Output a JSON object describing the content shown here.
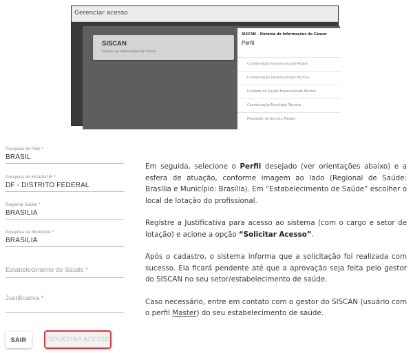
{
  "screenshot": {
    "header": "Gerenciar acesso",
    "card_title": "SISCAN",
    "card_subtitle": "Sistema de Informações do Câncer",
    "panel_system": "SISCAN - Sistema de Informações do Câncer",
    "panel_title": "Perfil",
    "profiles": [
      "Coordenação Intramunicipal Master",
      "Coordenação Intramunicipal Técnica",
      "Unidade de Saúde Especializada Master",
      "Coordenação Municipal Técnica",
      "Prestador de Serviço Master"
    ]
  },
  "form": {
    "pais_label": "Pesquisa de País *",
    "pais_value": "BRASIL",
    "estado_label": "Pesquisa de Estado/UF *",
    "estado_value": "DF - DISTRITO FEDERAL",
    "regional_label": "Regional Saúde *",
    "regional_value": "BRASILIA",
    "municipio_label": "Pesquisa de Município *",
    "municipio_value": "BRASILIA",
    "estabelecimento_placeholder": "Estabelecimento de Saúde *",
    "justificativa_placeholder": "Justificativa *",
    "sair_label": "SAIR",
    "solicitar_label": "SOLICITAR ACESSO"
  },
  "text": {
    "p1_a": "Em seguida, selecione o ",
    "p1_b": "Perfil",
    "p1_c": " desejado (ver orientações abaixo) e a esfera de atuação, conforme imagem ao lado (Regional de Saúde: Brasília e Município: Brasília). Em “Estabelecimento de Saúde” escolher o local de lotação do profissional.",
    "p2_a": "Registre a Justificativa para acesso ao sistema (com o cargo e setor de lotação) e acione a opção ",
    "p2_b": "“Solicitar Acesso”",
    "p2_c": ".",
    "p3": "Após o cadastro, o sistema informa que a solicitação foi realizada com sucesso. Ela ficará pendente até que a aprovação seja feita pelo gestor do SISCAN no seu setor/estabelecimento de saúde.",
    "p4_a": "Caso necessário, entre em contato com o gestor do SISCAN (usuário com o perfil ",
    "p4_b": "Master",
    "p4_c": ") do seu estabelecimento de saúde."
  },
  "colors": {
    "highlight_border": "#e0333a"
  }
}
